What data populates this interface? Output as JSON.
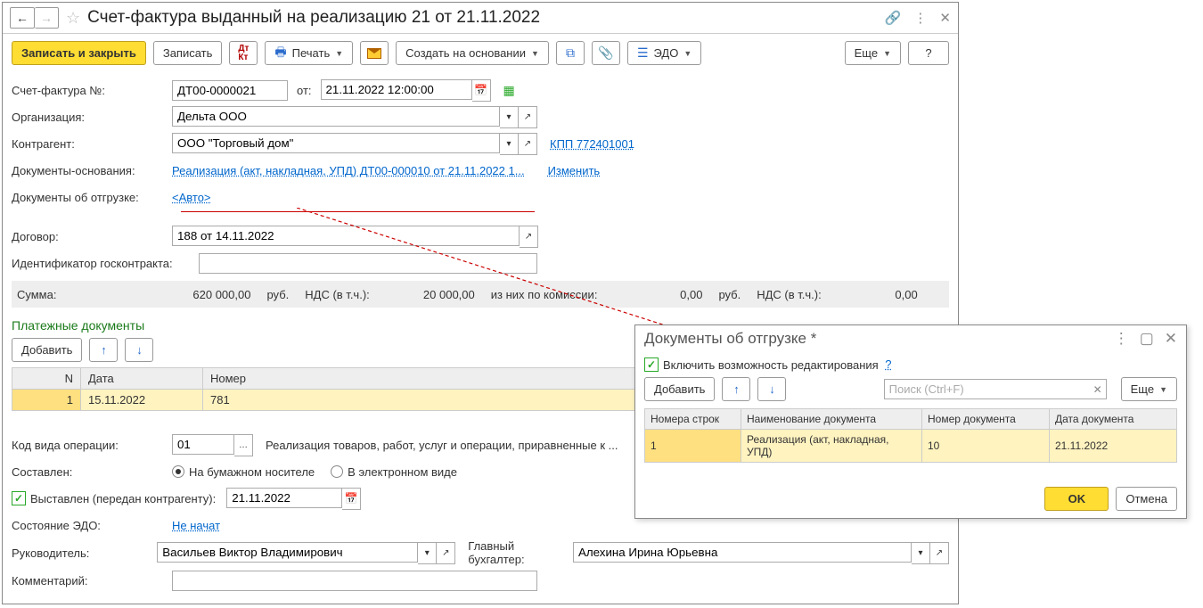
{
  "title": "Счет-фактура выданный на реализацию 21 от 21.11.2022",
  "toolbar": {
    "save_close": "Записать и закрыть",
    "save": "Записать",
    "print": "Печать",
    "create_based": "Создать на основании",
    "edo": "ЭДО",
    "more": "Еще",
    "help": "?"
  },
  "fields": {
    "number_lbl": "Счет-фактура №:",
    "number": "ДТ00-0000021",
    "from_lbl": "от:",
    "date": "21.11.2022 12:00:00",
    "org_lbl": "Организация:",
    "org": "Дельта ООО",
    "partner_lbl": "Контрагент:",
    "partner": "ООО \"Торговый дом\"",
    "kpp_link": "КПП 772401001",
    "basis_lbl": "Документы-основания:",
    "basis_link": "Реализация (акт, накладная, УПД) ДТ00-000010 от 21.11.2022 1...",
    "basis_change": "Изменить",
    "ship_lbl": "Документы об отгрузке:",
    "ship_link": "<Авто>",
    "contract_lbl": "Договор:",
    "contract": "188 от 14.11.2022",
    "gos_lbl": "Идентификатор госконтракта:",
    "gos": ""
  },
  "sums": {
    "sum_lbl": "Сумма:",
    "sum": "620 000,00",
    "cur1": "руб.",
    "vat_lbl": "НДС (в т.ч.):",
    "vat": "20 000,00",
    "comm_lbl": "из них по комиссии:",
    "comm": "0,00",
    "cur2": "руб.",
    "vat2_lbl": "НДС (в т.ч.):",
    "vat2": "0,00"
  },
  "payments": {
    "title": "Платежные документы",
    "add": "Добавить",
    "cols": {
      "n": "N",
      "date": "Дата",
      "num": "Номер"
    },
    "rows": [
      {
        "n": "1",
        "date": "15.11.2022",
        "num": "781"
      }
    ]
  },
  "lower": {
    "optype_lbl": "Код вида операции:",
    "optype": "01",
    "optype_desc": "Реализация товаров, работ, услуг и операции, приравненные к ...",
    "compiled_lbl": "Составлен:",
    "radio_paper": "На бумажном носителе",
    "radio_elec": "В электронном виде",
    "issued_lbl": "Выставлен (передан контрагенту):",
    "issued_date": "21.11.2022",
    "edo_state_lbl": "Состояние ЭДО:",
    "edo_state": "Не начат",
    "head_lbl": "Руководитель:",
    "head": "Васильев Виктор Владимирович",
    "chief_lbl": "Главный бухгалтер:",
    "chief": "Алехина Ирина Юрьевна",
    "comment_lbl": "Комментарий:",
    "comment": ""
  },
  "dialog": {
    "title": "Документы об отгрузке *",
    "enable_edit": "Включить возможность редактирования",
    "add": "Добавить",
    "search_ph": "Поиск (Ctrl+F)",
    "more": "Еще",
    "cols": {
      "n": "Номера строк",
      "name": "Наименование документа",
      "num": "Номер документа",
      "date": "Дата документа"
    },
    "rows": [
      {
        "n": "1",
        "name": "Реализация (акт, накладная, УПД)",
        "num": "10",
        "date": "21.11.2022"
      }
    ],
    "ok": "OK",
    "cancel": "Отмена"
  }
}
